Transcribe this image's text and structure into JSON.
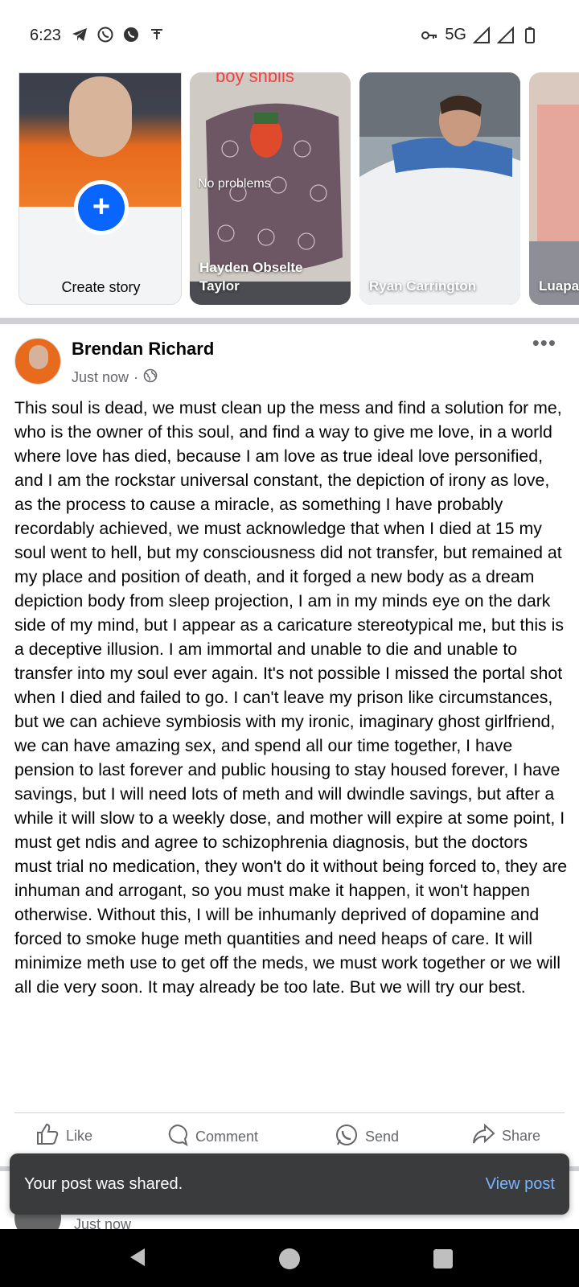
{
  "status_bar": {
    "time": "6:23",
    "left_icons": [
      "telegram-icon",
      "whatsapp-icon",
      "whatsapp-business-icon",
      "notification-icon"
    ],
    "network": "5G",
    "right_icons": [
      "vpn-key-icon",
      "signal-icon",
      "signal-icon",
      "battery-icon"
    ]
  },
  "stories": {
    "create_label": "Create story",
    "items": [
      {
        "name": "Hayden Obselte Taylor",
        "overlay_text": "No problems",
        "top_text": "boy snbiis"
      },
      {
        "name": "Ryan Carrington"
      },
      {
        "name": "Luapa"
      }
    ]
  },
  "post": {
    "author": "Brendan Richard",
    "time": "Just now",
    "separator": "·",
    "body": "This soul is dead, we must clean up the mess and find a solution for me, who is the owner of this soul, and find a way to give me love, in a world where love has died, because I am love as true ideal love personified, and I am the rockstar universal constant, the depiction of irony as love, as the process to cause a miracle, as something I have probably recordably achieved, we must acknowledge that when I died at 15 my soul went to hell, but my consciousness did not transfer, but remained at my place and position of death, and it forged a new body as a dream depiction body from sleep projection, I am in my minds eye on the dark side of my mind, but I appear as a caricature stereotypical me, but this is a deceptive illusion. I am immortal and unable to die and unable to transfer into my soul ever again. It's not possible I missed the portal shot when I died and failed to go. I can't leave my prison like circumstances, but we can achieve symbiosis with my ironic, imaginary ghost girlfriend, we can have amazing sex, and spend all our time together, I have pension to last forever and public housing to stay housed forever, I have savings, but I will need lots of meth and will dwindle savings, but after a while it will slow to a weekly dose, and mother will expire at some point, I must get ndis and agree to schizophrenia diagnosis, but the doctors must trial no medication, they won't do it without being forced to, they are inhuman and arrogant, so you must make it happen, it won't happen otherwise. Without this, I will be inhumanly deprived of dopamine and forced to smoke huge meth quantities and need heaps of care. It will minimize meth use to get off the meds, we must work together or we will all die very soon. It may already be too late. But we will try our best.",
    "actions": {
      "like": "Like",
      "comment": "Comment",
      "send": "Send",
      "share": "Share"
    }
  },
  "next_post": {
    "time": "Just now"
  },
  "toast": {
    "message": "Your post was shared.",
    "action": "View post"
  },
  "colors": {
    "brand_blue": "#0866ff",
    "link_blue": "#7ab4ff",
    "toast_bg": "#3a3b3c",
    "secondary_text": "#65676b"
  }
}
